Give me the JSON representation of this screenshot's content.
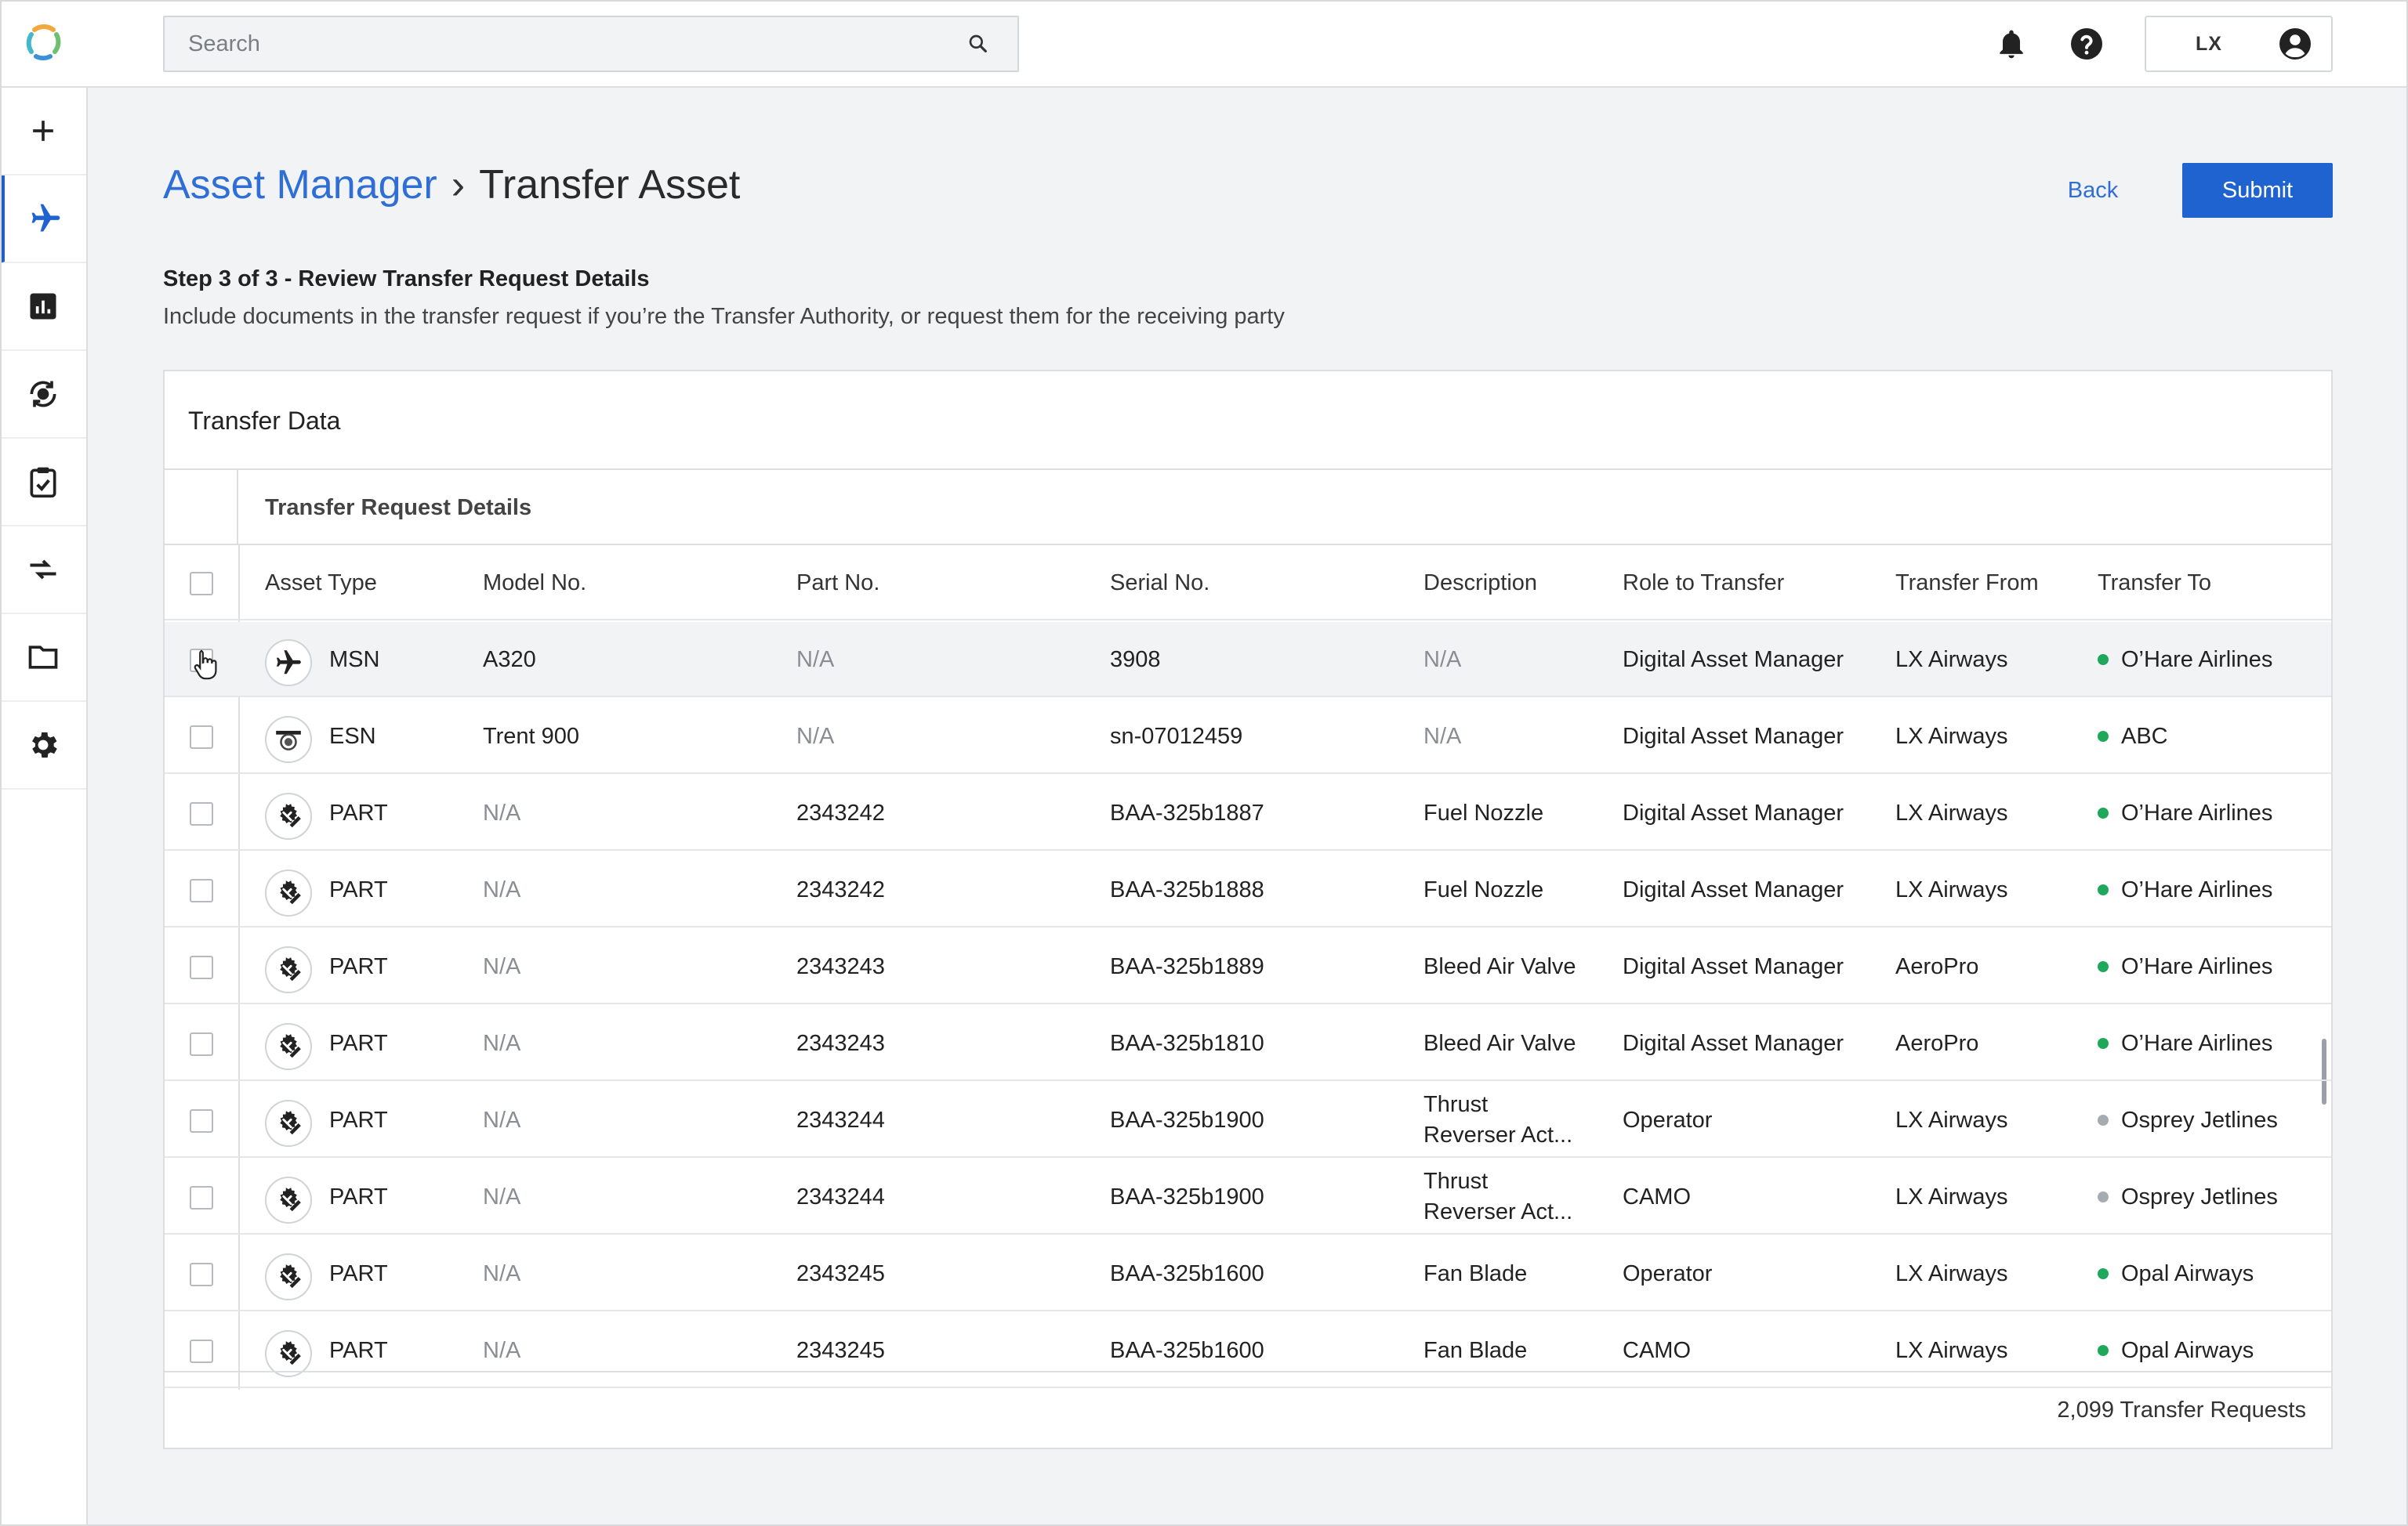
{
  "topbar": {
    "search_placeholder": "Search",
    "user_initials": "LX"
  },
  "sidebar": {
    "items": [
      {
        "icon": "plus-icon"
      },
      {
        "icon": "airplane-icon",
        "active": true
      },
      {
        "icon": "chart-icon"
      },
      {
        "icon": "sync-engine-icon"
      },
      {
        "icon": "clipboard-check-icon"
      },
      {
        "icon": "transfer-arrows-icon"
      },
      {
        "icon": "folder-icon"
      },
      {
        "icon": "gear-icon"
      }
    ]
  },
  "header": {
    "breadcrumb_link": "Asset Manager",
    "breadcrumb_sep": "›",
    "breadcrumb_current": "Transfer Asset",
    "back_label": "Back",
    "submit_label": "Submit",
    "step_title": "Step 3 of 3 - Review Transfer Request Details",
    "step_desc": "Include documents in the transfer request if you’re the Transfer Authority, or request them for the receiving party"
  },
  "card": {
    "title": "Transfer Data",
    "group_label": "Transfer Request Details",
    "columns": [
      "Asset Type",
      "Model No.",
      "Part No.",
      "Serial No.",
      "Description",
      "Role to Transfer",
      "Transfer From",
      "Transfer To"
    ],
    "rows": [
      {
        "icon": "airplane-icon",
        "type": "MSN",
        "model": "A320",
        "part": "N/A",
        "serial": "3908",
        "desc": "N/A",
        "role": "Digital Asset Manager",
        "from": "LX Airways",
        "to": "O’Hare Airlines",
        "status": "green"
      },
      {
        "icon": "engine-icon",
        "type": "ESN",
        "model": "Trent 900",
        "part": "N/A",
        "serial": "sn-07012459",
        "desc": "N/A",
        "role": "Digital Asset Manager",
        "from": "LX Airways",
        "to": "ABC",
        "status": "green"
      },
      {
        "icon": "part-icon",
        "type": "PART",
        "model": "N/A",
        "part": "2343242",
        "serial": "BAA-325b1887",
        "desc": "Fuel Nozzle",
        "role": "Digital Asset Manager",
        "from": "LX Airways",
        "to": "O’Hare Airlines",
        "status": "green"
      },
      {
        "icon": "part-icon",
        "type": "PART",
        "model": "N/A",
        "part": "2343242",
        "serial": "BAA-325b1888",
        "desc": "Fuel Nozzle",
        "role": "Digital Asset Manager",
        "from": "LX Airways",
        "to": "O’Hare Airlines",
        "status": "green"
      },
      {
        "icon": "part-icon",
        "type": "PART",
        "model": "N/A",
        "part": "2343243",
        "serial": "BAA-325b1889",
        "desc": "Bleed Air Valve",
        "role": "Digital Asset Manager",
        "from": "AeroPro",
        "to": "O’Hare Airlines",
        "status": "green"
      },
      {
        "icon": "part-icon",
        "type": "PART",
        "model": "N/A",
        "part": "2343243",
        "serial": "BAA-325b1810",
        "desc": "Bleed Air Valve",
        "role": "Digital Asset Manager",
        "from": "AeroPro",
        "to": "O’Hare Airlines",
        "status": "green"
      },
      {
        "icon": "part-icon",
        "type": "PART",
        "model": "N/A",
        "part": "2343244",
        "serial": "BAA-325b1900",
        "desc": "Thrust Reverser Act...",
        "role": "Operator",
        "from": "LX Airways",
        "to": "Osprey Jetlines",
        "status": "gray"
      },
      {
        "icon": "part-icon",
        "type": "PART",
        "model": "N/A",
        "part": "2343244",
        "serial": "BAA-325b1900",
        "desc": "Thrust Reverser Act...",
        "role": "CAMO",
        "from": "LX Airways",
        "to": "Osprey Jetlines",
        "status": "gray"
      },
      {
        "icon": "part-icon",
        "type": "PART",
        "model": "N/A",
        "part": "2343245",
        "serial": "BAA-325b1600",
        "desc": "Fan Blade",
        "role": "Operator",
        "from": "LX Airways",
        "to": "Opal Airways",
        "status": "green"
      },
      {
        "icon": "part-icon",
        "type": "PART",
        "model": "N/A",
        "part": "2343245",
        "serial": "BAA-325b1600",
        "desc": "Fan Blade",
        "role": "CAMO",
        "from": "LX Airways",
        "to": "Opal Airways",
        "status": "green"
      }
    ],
    "footer_count": "2,099 Transfer Requests"
  },
  "colors": {
    "accent": "#1f63d0",
    "link": "#2f6ed6",
    "status_green": "#1fa85b",
    "status_gray": "#a6abb2"
  }
}
